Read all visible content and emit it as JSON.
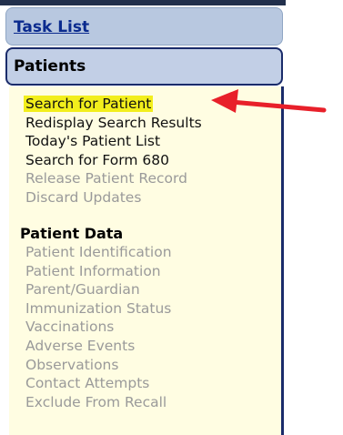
{
  "nav": {
    "task_list": "Task List",
    "patients": "Patients"
  },
  "patients_menu": {
    "items": [
      {
        "label": "Search for Patient",
        "enabled": true,
        "highlighted": true
      },
      {
        "label": "Redisplay Search Results",
        "enabled": true
      },
      {
        "label": "Today's Patient List",
        "enabled": true
      },
      {
        "label": "Search for Form 680",
        "enabled": true
      },
      {
        "label": "Release Patient Record",
        "enabled": false
      },
      {
        "label": "Discard Updates",
        "enabled": false
      }
    ]
  },
  "patient_data": {
    "header": "Patient Data",
    "items": [
      {
        "label": "Patient Identification",
        "enabled": false
      },
      {
        "label": "Patient Information",
        "enabled": false
      },
      {
        "label": "Parent/Guardian",
        "enabled": false
      },
      {
        "label": "Immunization Status",
        "enabled": false
      },
      {
        "label": "Vaccinations",
        "enabled": false
      },
      {
        "label": "Adverse Events",
        "enabled": false
      },
      {
        "label": "Observations",
        "enabled": false
      },
      {
        "label": "Contact Attempts",
        "enabled": false
      },
      {
        "label": "Exclude From Recall",
        "enabled": false
      }
    ]
  },
  "annotation": {
    "arrow_color": "#e8202a",
    "arrow_icon": "left-arrow-icon"
  },
  "colors": {
    "highlight": "#f2ee1c",
    "menu_background": "#fffde2",
    "nav_pill": "#b8c8e0",
    "link": "#0a2a8e",
    "disabled_text": "#9a9a9a"
  }
}
